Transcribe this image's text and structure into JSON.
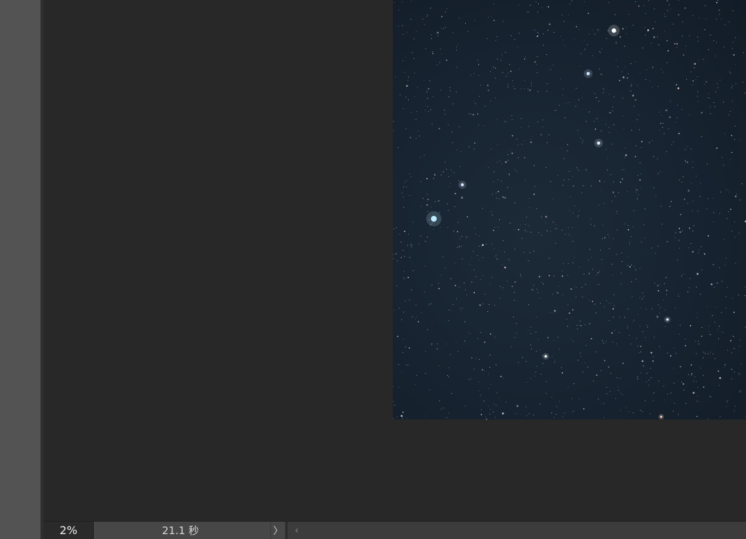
{
  "status_bar": {
    "zoom": "2%",
    "doc_info": "21.1 秒"
  },
  "icons": {
    "status_menu_arrow": "chevron-right-icon",
    "scroll_left": "chevron-left-icon"
  },
  "colors": {
    "workspace": "#282828",
    "toolbar": "#535353",
    "status_bar": "#3c3c3c",
    "image_sky": "#172330"
  }
}
